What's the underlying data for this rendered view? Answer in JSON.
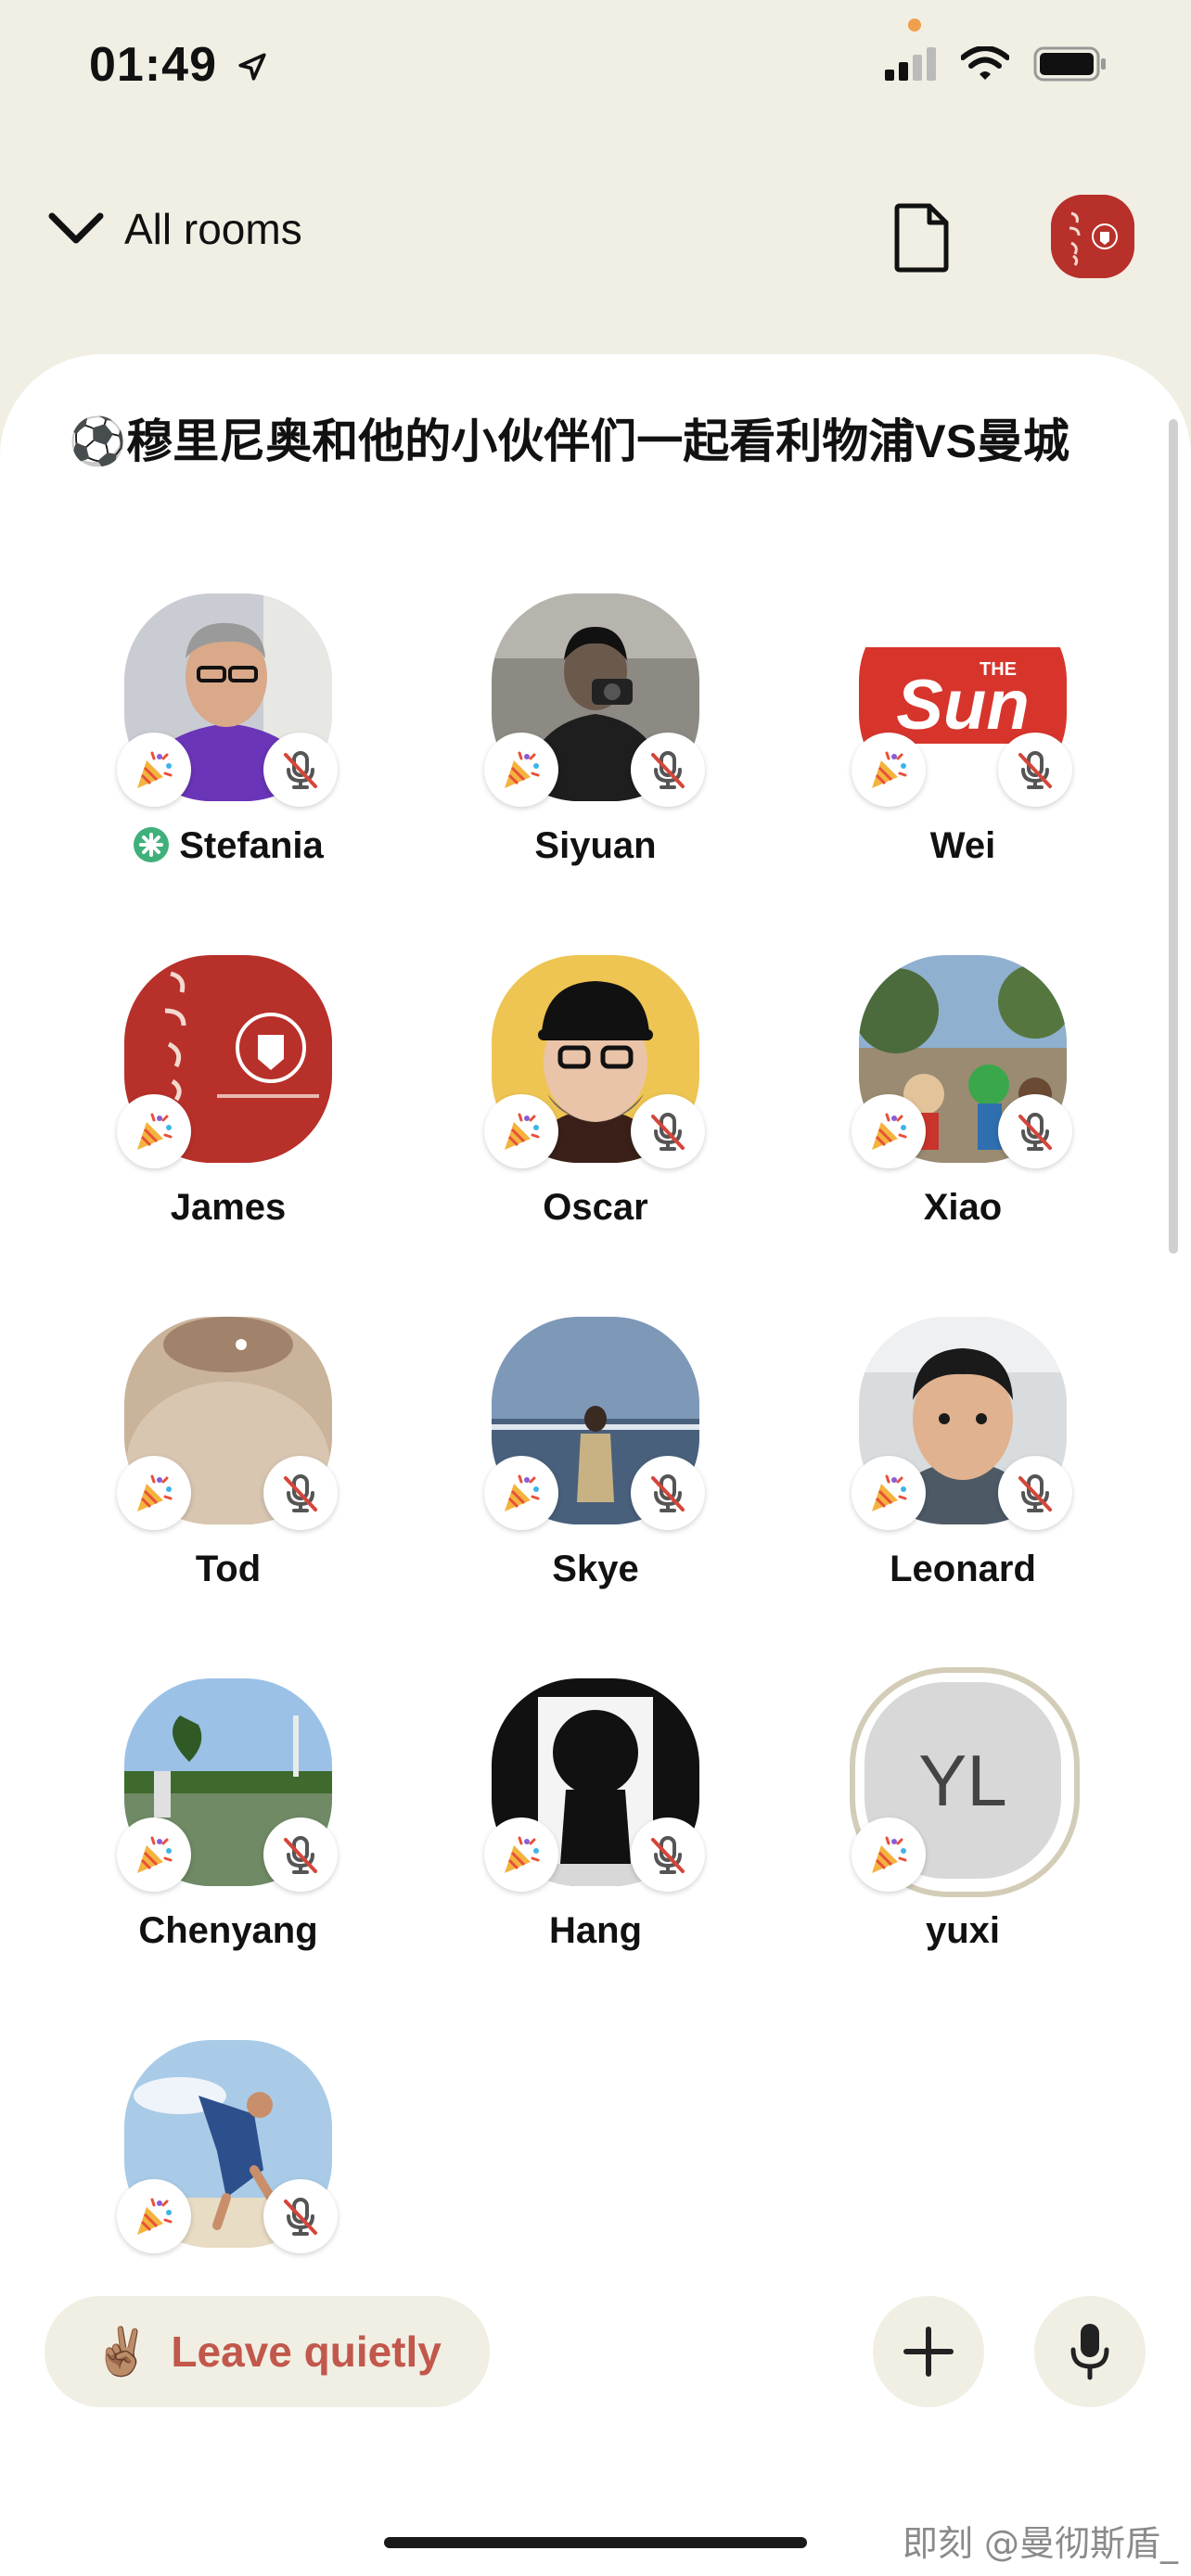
{
  "status_bar": {
    "time": "01:49"
  },
  "header": {
    "back_label": "All rooms"
  },
  "room": {
    "title": "⚽️穆里尼奥和他的小伙伴们一起看利物浦VS曼城"
  },
  "members": [
    {
      "name": "Stefania",
      "moderator": true
    },
    {
      "name": "Siyuan"
    },
    {
      "name": "Wei",
      "avatar_text": "Sun",
      "avatar_text_small": "THE"
    },
    {
      "name": "James"
    },
    {
      "name": "Oscar"
    },
    {
      "name": "Xiao"
    },
    {
      "name": "Tod"
    },
    {
      "name": "Skye"
    },
    {
      "name": "Leonard"
    },
    {
      "name": "Chenyang"
    },
    {
      "name": "Hang"
    },
    {
      "name": "yuxi",
      "initials": "YL"
    },
    {
      "name": ""
    }
  ],
  "bottom_bar": {
    "leave_emoji": "✌🏽",
    "leave_label": "Leave quietly"
  },
  "watermark": "即刻 @曼彻斯盾_",
  "colors": {
    "background": "#f1efe4",
    "card": "#ffffff",
    "leave_text": "#c2574b",
    "room_avatar": "#b8302a"
  },
  "icons": [
    "location-arrow-icon",
    "signal-icon",
    "wifi-icon",
    "battery-icon",
    "chevron-down-icon",
    "document-icon",
    "party-popper-icon",
    "mic-muted-icon",
    "plus-icon",
    "mic-icon",
    "moderator-icon"
  ]
}
